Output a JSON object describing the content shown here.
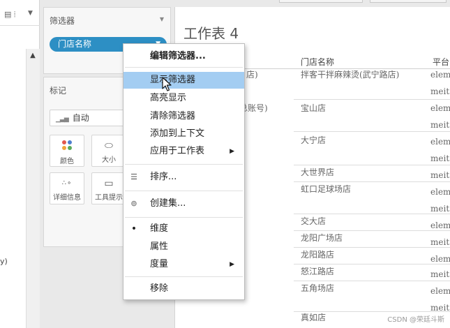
{
  "left_pane": {
    "partial_text": "y)"
  },
  "filters_card": {
    "title": "筛选器",
    "pill_label": "门店名称"
  },
  "marks_card": {
    "title": "标记",
    "mark_type": "自动",
    "buttons": [
      {
        "label": "颜色",
        "icon": "color-icon"
      },
      {
        "label": "大小",
        "icon": "size-icon"
      },
      {
        "label": "详细信息",
        "icon": "detail-icon"
      },
      {
        "label": "工具提示",
        "icon": "tooltip-icon"
      }
    ]
  },
  "worksheet": {
    "title": "工作表 4",
    "columns": [
      "门店名称",
      "平台"
    ],
    "left_fragments": [
      "店)",
      "（总账号)"
    ],
    "stores": [
      "拌客干拌麻辣烫(武宁路店)",
      "宝山店",
      "大宁店",
      "大世界店",
      "虹口足球场店",
      "交大店",
      "龙阳广场店",
      "龙阳路店",
      "怒江路店",
      "五角场店",
      "真如店"
    ],
    "platforms": [
      "elem",
      "meit",
      "elem",
      "meit",
      "elem",
      "meit",
      "meit",
      "elem",
      "meit",
      "elem",
      "meit",
      "elem",
      "meit",
      "elem",
      "meit",
      "elem",
      "meit",
      "meit"
    ]
  },
  "context_menu": {
    "items": [
      {
        "label": "编辑筛选器...",
        "highlighted": false,
        "submenu": false
      },
      {
        "label": "显示筛选器",
        "highlighted": true,
        "submenu": false
      },
      {
        "label": "高亮显示",
        "highlighted": false,
        "submenu": false
      },
      {
        "label": "清除筛选器",
        "highlighted": false,
        "submenu": false
      },
      {
        "label": "添加到上下文",
        "highlighted": false,
        "submenu": false
      },
      {
        "label": "应用于工作表",
        "highlighted": false,
        "submenu": true
      },
      {
        "label": "排序...",
        "icon": "sort-icon",
        "submenu": false
      },
      {
        "label": "创建集...",
        "icon": "create-set-icon",
        "submenu": false
      },
      {
        "label": "维度",
        "checked": true,
        "submenu": false
      },
      {
        "label": "属性",
        "submenu": false
      },
      {
        "label": "度量",
        "submenu": true
      },
      {
        "label": "移除",
        "submenu": false
      }
    ]
  },
  "colors": {
    "pill_blue": "#2d8fc4",
    "menu_highlight": "#a3cdf2",
    "dot_red": "#e2584f",
    "dot_blue": "#4f7fcf",
    "dot_orange": "#f0a43a",
    "dot_green": "#5aaa5a"
  },
  "watermark": "CSDN @荣廷斗斯"
}
